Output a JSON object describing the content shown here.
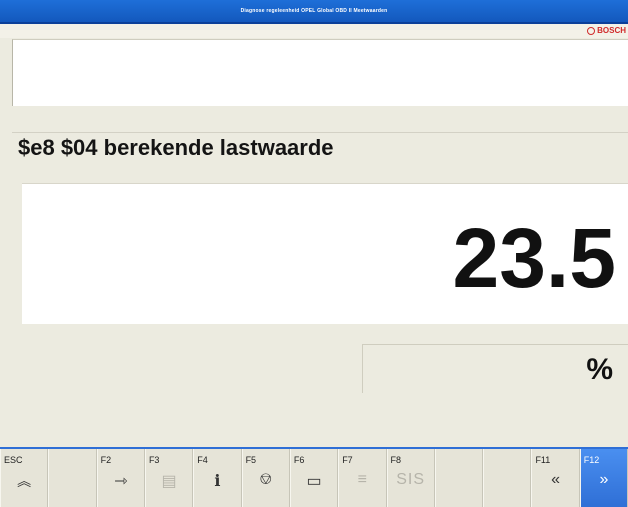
{
  "window": {
    "title": "Diagnose regeleenheid OPEL Global OBD II Meetwaarden",
    "brand": "BOSCH"
  },
  "parameter": {
    "label": "$e8 $04 berekende  lastwaarde",
    "value": "23.5",
    "unit": "%"
  },
  "fkeys": [
    {
      "key": "ESC",
      "icon": "≪",
      "icon_name": "up-double-chevron-icon",
      "enabled": true
    },
    {
      "key": "",
      "icon": "",
      "icon_name": "",
      "enabled": false
    },
    {
      "key": "F2",
      "icon": "⇾",
      "icon_name": "enter-arrow-icon",
      "enabled": true
    },
    {
      "key": "F3",
      "icon": "▤",
      "icon_name": "print-icon",
      "enabled": false
    },
    {
      "key": "F4",
      "icon": "i",
      "icon_name": "info-icon",
      "enabled": true
    },
    {
      "key": "F5",
      "icon": "⌂",
      "icon_name": "vehicle-icon",
      "enabled": true
    },
    {
      "key": "F6",
      "icon": "▭",
      "icon_name": "window-icon",
      "enabled": true
    },
    {
      "key": "F7",
      "icon": "≡",
      "icon_name": "list-icon",
      "enabled": false
    },
    {
      "key": "F8",
      "icon": "SIS",
      "icon_name": "sis-icon",
      "enabled": false
    },
    {
      "key": "",
      "icon": "",
      "icon_name": "",
      "enabled": false
    },
    {
      "key": "",
      "icon": "",
      "icon_name": "",
      "enabled": false
    },
    {
      "key": "F11",
      "icon": "«",
      "icon_name": "page-back-icon",
      "enabled": true
    },
    {
      "key": "F12",
      "icon": "»",
      "icon_name": "page-forward-icon",
      "enabled": true,
      "active": true
    }
  ],
  "colors": {
    "titlebar": "#1358bd",
    "accent": "#2f6fd6",
    "background": "#ecebe0"
  }
}
